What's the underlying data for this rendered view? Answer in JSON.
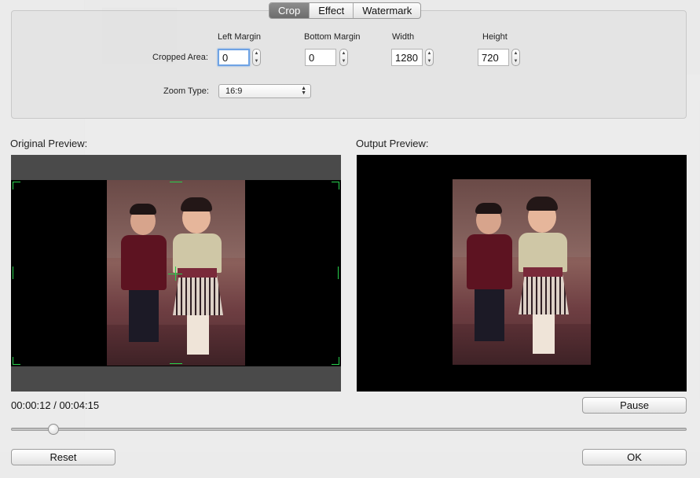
{
  "tabs": [
    {
      "label": "Crop",
      "active": true
    },
    {
      "label": "Effect",
      "active": false
    },
    {
      "label": "Watermark",
      "active": false
    }
  ],
  "crop": {
    "cropped_area_label": "Cropped Area:",
    "left_margin": {
      "label": "Left Margin",
      "value": "0"
    },
    "bottom_margin": {
      "label": "Bottom Margin",
      "value": "0"
    },
    "width": {
      "label": "Width",
      "value": "1280"
    },
    "height": {
      "label": "Height",
      "value": "720"
    },
    "zoom_type_label": "Zoom Type:",
    "zoom_type_value": "16:9"
  },
  "preview": {
    "original_label": "Original Preview:",
    "output_label": "Output Preview:"
  },
  "playback": {
    "time_display": "00:00:12 / 00:04:15",
    "progress_fraction": 0.055,
    "pause_label": "Pause"
  },
  "footer": {
    "reset_label": "Reset",
    "ok_label": "OK"
  },
  "colors": {
    "crop_guide": "#27d04c",
    "focus_ring": "#6fa3e4",
    "active_tab": "#7a7a7a"
  },
  "icons": {
    "stepper": "stepper-arrows-icon",
    "select_arrows": "updown-arrows-icon"
  }
}
